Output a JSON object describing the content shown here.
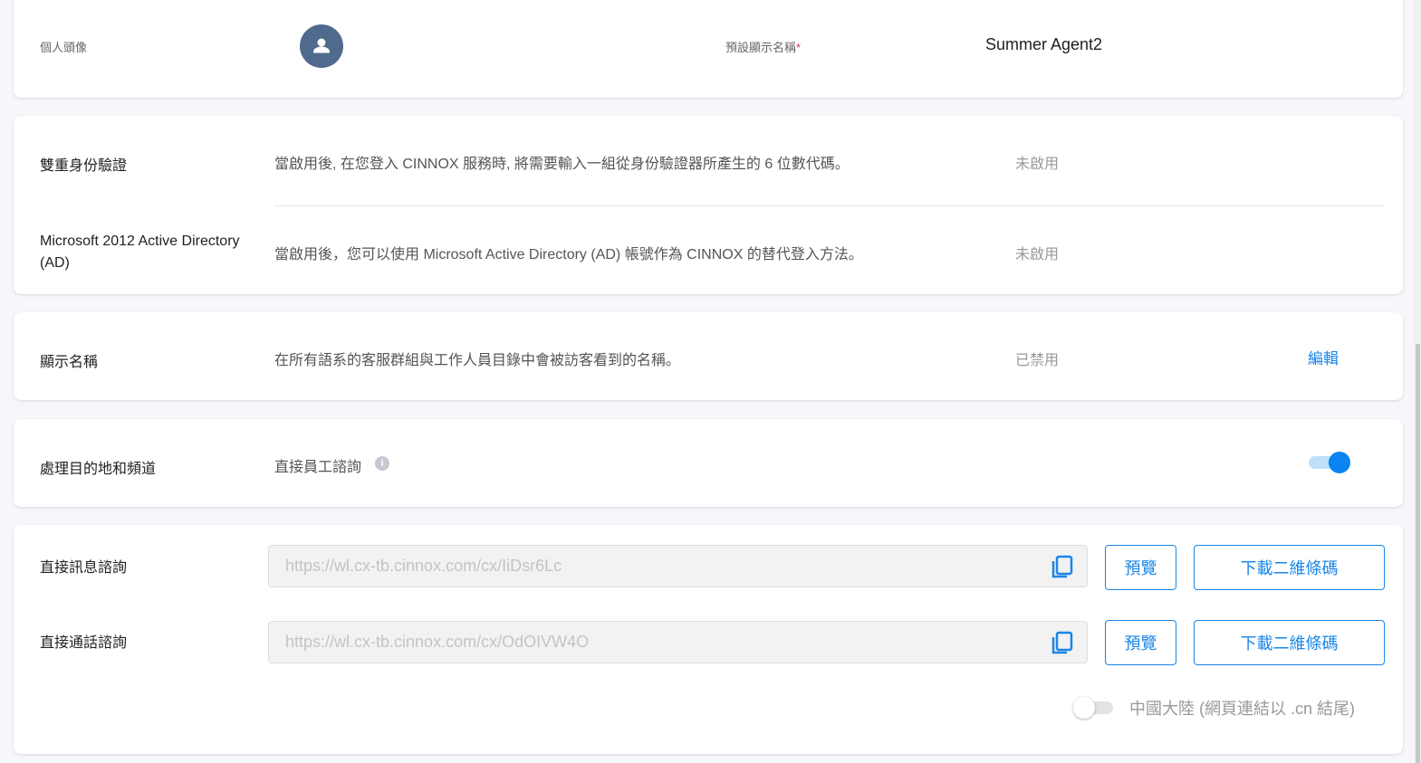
{
  "profile": {
    "avatar_label": "個人頭像",
    "display_name_label": "預設顯示名稱",
    "required_mark": "*",
    "display_name_value": "Summer Agent2"
  },
  "security": [
    {
      "label": "雙重身份驗證",
      "description": "當啟用後, 在您登入 CINNOX 服務時, 將需要輸入一組從身份驗證器所產生的 6 位數代碼。",
      "status": "未啟用"
    },
    {
      "label": "Microsoft 2012 Active Directory (AD)",
      "description": "當啟用後，您可以使用 Microsoft Active Directory (AD) 帳號作為 CINNOX 的替代登入方法。",
      "status": "未啟用"
    }
  ],
  "display_name": {
    "label": "顯示名稱",
    "description": "在所有語系的客服群組與工作人員目錄中會被訪客看到的名稱。",
    "status": "已禁用",
    "edit_label": "編輯"
  },
  "destinations": {
    "label": "處理目的地和頻道",
    "option": "直接員工諮詢",
    "toggle_on": true
  },
  "links": [
    {
      "label": "直接訊息諮詢",
      "url": "https://wl.cx-tb.cinnox.com/cx/IiDsr6Lc",
      "preview": "預覽",
      "download": "下載二維條碼"
    },
    {
      "label": "直接通話諮詢",
      "url": "https://wl.cx-tb.cinnox.com/cx/OdOIVW4O",
      "preview": "預覽",
      "download": "下載二維條碼"
    }
  ],
  "china": {
    "label": "中國大陸 (網頁連結以 .cn 結尾)",
    "toggle_on": false
  },
  "colors": {
    "accent": "#1a86e6",
    "avatar": "#4f6a8c"
  }
}
